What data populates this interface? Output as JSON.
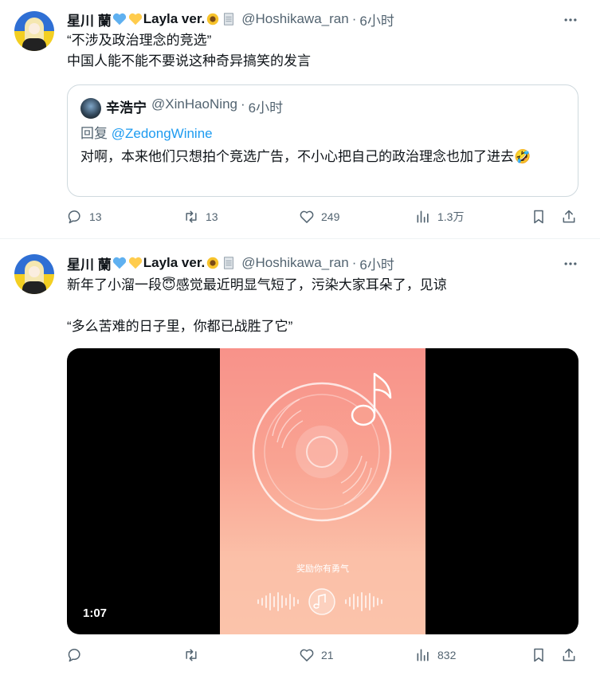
{
  "tweets": [
    {
      "display_name": "星川 蘭",
      "name_suffix": "Layla ver.",
      "handle": "@Hoshikawa_ran",
      "time": "6小时",
      "text": "“不涉及政治理念的竞选”\n中国人能不能不要说这种奇异搞笑的发言",
      "quote": {
        "display_name": "辛浩宁",
        "handle": "@XinHaoNing",
        "time": "6小时",
        "reply_prefix": "回复",
        "reply_to": "@ZedongWinine",
        "text": "对啊，本来他们只想拍个竞选广告，不小心把自己的政治理念也加了进去🤣"
      },
      "actions": {
        "replies": "13",
        "retweets": "13",
        "likes": "249",
        "views": "1.3万"
      }
    },
    {
      "display_name": "星川 蘭",
      "name_suffix": "Layla ver.",
      "handle": "@Hoshikawa_ran",
      "time": "6小时",
      "text": "新年了小溜一段😇感觉最近明显气短了，污染大家耳朵了，见谅\n\n“多么苦难的日子里，你都已战胜了它”",
      "video": {
        "caption": "奖励你有勇气",
        "duration": "1:07"
      },
      "actions": {
        "replies": "",
        "retweets": "",
        "likes": "21",
        "views": "832"
      }
    }
  ],
  "separator": "·",
  "icons": [
    "more-icon",
    "reply-icon",
    "retweet-icon",
    "like-icon",
    "views-icon",
    "bookmark-icon",
    "share-icon",
    "music-disc-icon",
    "audio-wave-icon"
  ],
  "colors": {
    "text": "#0f1419",
    "secondary": "#536471",
    "link": "#1d9bf0",
    "border": "#cfd9de"
  }
}
